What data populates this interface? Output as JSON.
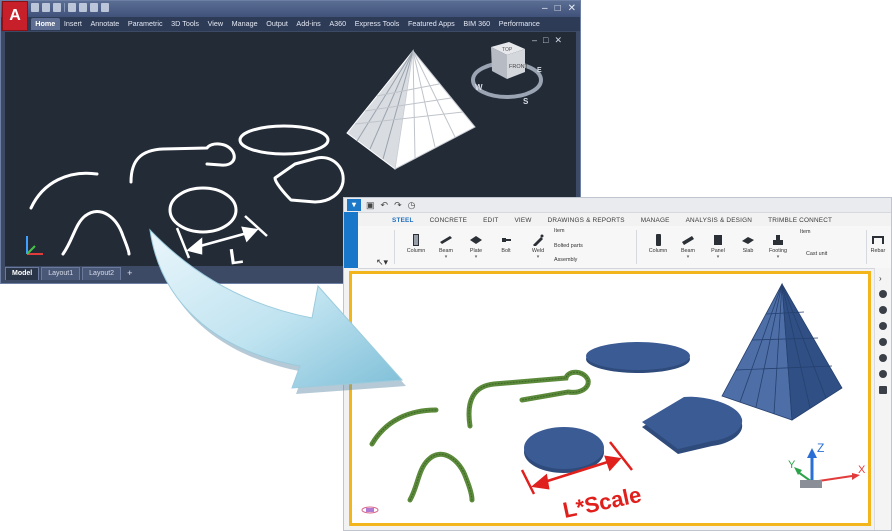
{
  "autocad": {
    "logo": "A",
    "menu_tabs": [
      "Home",
      "Insert",
      "Annotate",
      "Parametric",
      "3D Tools",
      "View",
      "Manage",
      "Output",
      "Add-ins",
      "A360",
      "Express Tools",
      "Featured Apps",
      "BIM 360",
      "Performance"
    ],
    "window_buttons": [
      "–",
      "□",
      "✕"
    ],
    "doc_buttons": [
      "–",
      "□",
      "✕"
    ],
    "viewcube": {
      "top": "TOP",
      "front": "FRONT",
      "compass": {
        "w": "W",
        "s": "S",
        "e": "E"
      }
    },
    "dimension_label": "L",
    "layout_tabs": [
      "Model",
      "Layout1",
      "Layout2"
    ],
    "add_layout": "+",
    "colors": {
      "canvas": "#232b37",
      "window": "#3c4a66",
      "linework": "#ffffff"
    }
  },
  "tekla": {
    "ribbon_tabs": [
      "STEEL",
      "CONCRETE",
      "EDIT",
      "VIEW",
      "DRAWINGS & REPORTS",
      "MANAGE",
      "ANALYSIS & DESIGN",
      "TRIMBLE CONNECT"
    ],
    "steel_tools": [
      "Column",
      "Beam",
      "Plate",
      "Bolt",
      "Weld"
    ],
    "steel_small": [
      "Item",
      "Bolted parts",
      "Assembly"
    ],
    "concrete_tools": [
      "Column",
      "Beam",
      "Panel",
      "Slab",
      "Footing"
    ],
    "concrete_small": [
      "Item",
      "Cast unit"
    ],
    "last_tool": "Rebar",
    "dimension_label": "L*Scale",
    "axes": {
      "x": "X",
      "y": "Y",
      "z": "Z"
    },
    "colors": {
      "highlight_border": "#f2b61c",
      "solid": "#3b5b94",
      "curve": "#5b8a3a",
      "dimension": "#e0201c",
      "tab_accent": "#1e6fc0"
    }
  }
}
